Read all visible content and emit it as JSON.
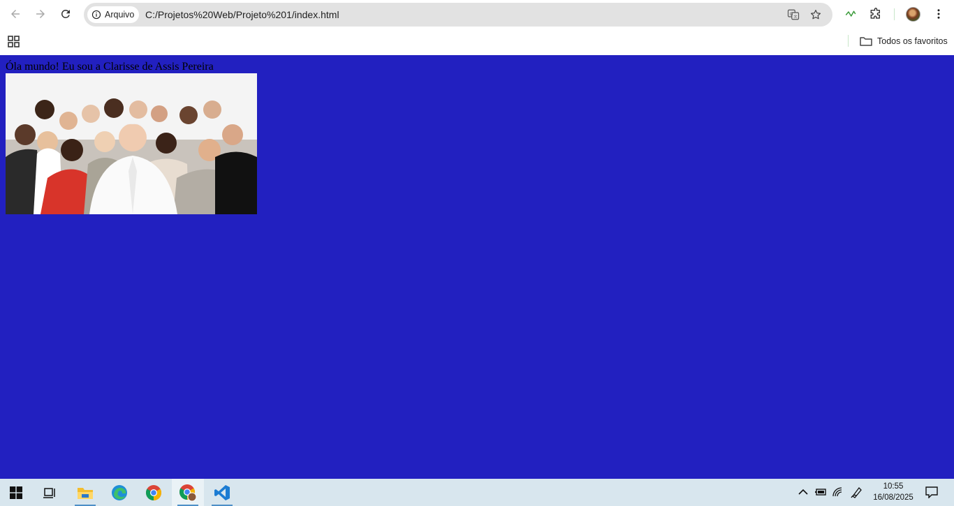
{
  "browser": {
    "security_chip": "Arquivo",
    "url": "C:/Projetos%20Web/Projeto%201/index.html",
    "bookmark_folder": "Todos os favoritos"
  },
  "page": {
    "greeting": "Óla mundo! Eu sou a Clarisse de Assis Pereira",
    "background_color": "#2220c0",
    "image_subject": "group photo of smiling diverse people"
  },
  "taskbar": {
    "apps": [
      "start-menu",
      "task-view",
      "file-explorer",
      "edge",
      "chrome",
      "chrome-profile",
      "vscode"
    ],
    "time": "10:55",
    "date": "16/08/2025"
  },
  "colors": {
    "accent": "#4c8fc7",
    "toolbar_bg": "#ffffff",
    "omnibox_bg": "#e2e2e2",
    "taskbar_bg": "#d8e6ee"
  }
}
